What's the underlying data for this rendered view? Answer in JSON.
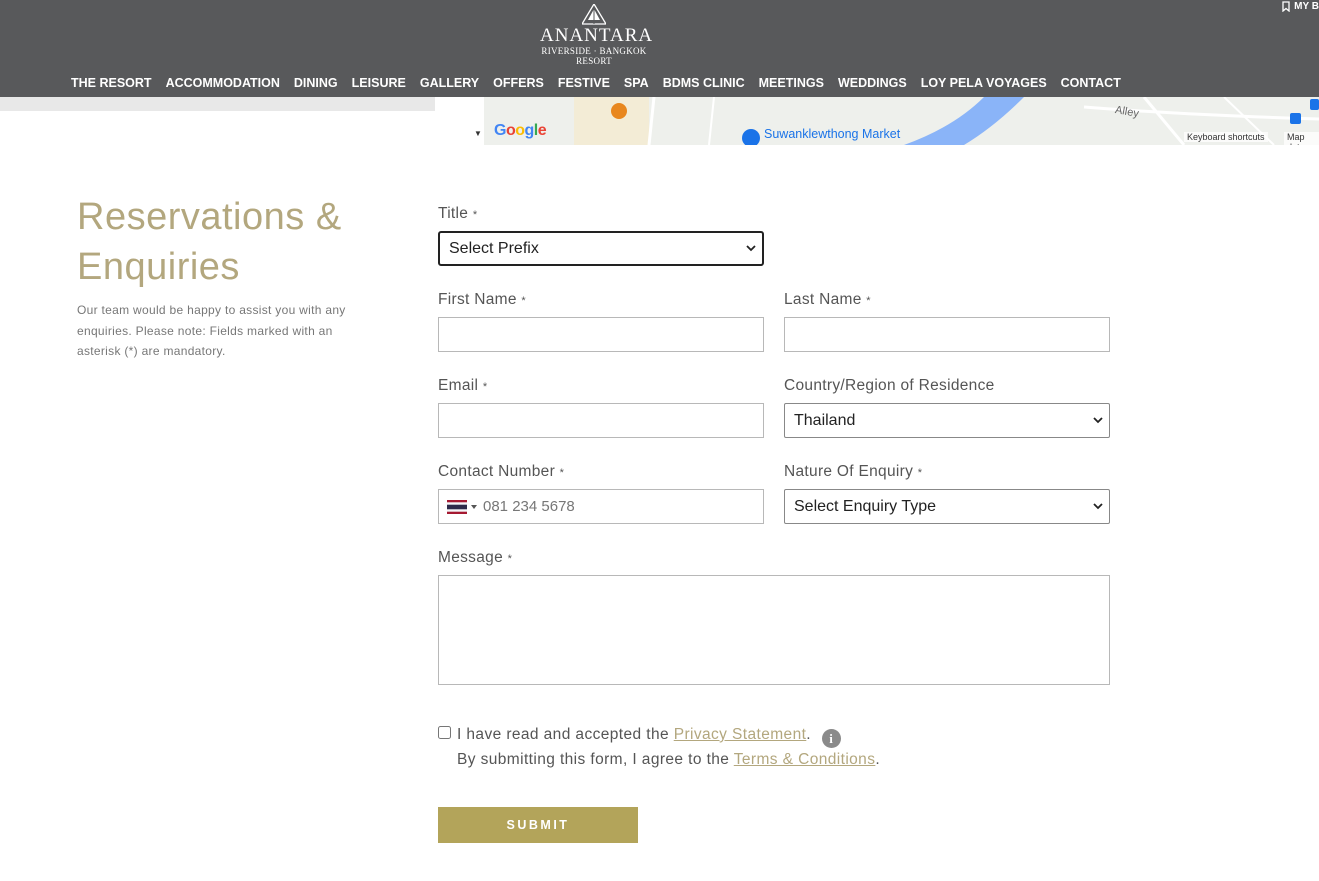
{
  "header": {
    "logo": {
      "name": "ANANTARA",
      "sub1": "RIVERSIDE · BANGKOK",
      "sub2": "RESORT"
    },
    "my_booking": "MY B",
    "nav": [
      "THE RESORT",
      "ACCOMMODATION",
      "DINING",
      "LEISURE",
      "GALLERY",
      "OFFERS",
      "FESTIVE",
      "SPA",
      "BDMS CLINIC",
      "MEETINGS",
      "WEDDINGS",
      "LOY PELA VOYAGES",
      "CONTACT"
    ]
  },
  "map": {
    "google": "Google",
    "market": "Suwanklewthong Market",
    "alley": "Alley",
    "keyboard_shortcuts": "Keyboard shortcuts",
    "map_data": "Map dat"
  },
  "intro": {
    "title": "Reservations & Enquiries",
    "text": "Our team would be happy to assist you with any enquiries. Please note: Fields marked with an asterisk (*) are mandatory."
  },
  "form": {
    "required_mark": "*",
    "title_label": "Title",
    "title_value": "Select Prefix",
    "first_name_label": "First Name",
    "first_name_value": "",
    "last_name_label": "Last Name",
    "last_name_value": "",
    "email_label": "Email",
    "email_value": "",
    "country_label": "Country/Region of Residence",
    "country_value": "Thailand",
    "contact_label": "Contact Number",
    "contact_placeholder": "081 234 5678",
    "enquiry_label": "Nature Of Enquiry",
    "enquiry_value": "Select Enquiry Type",
    "message_label": "Message",
    "consent_prefix": "I have read and accepted the",
    "privacy_link": "Privacy Statement",
    "consent_period": ".",
    "terms_prefix": "By submitting this form, I agree to the",
    "terms_link": "Terms & Conditions",
    "terms_period": ".",
    "info_icon": "i",
    "submit": "SUBMIT"
  },
  "colors": {
    "header_bg": "#58595b",
    "accent_gold": "#b3a77e",
    "submit_bg": "#b3a45a"
  }
}
